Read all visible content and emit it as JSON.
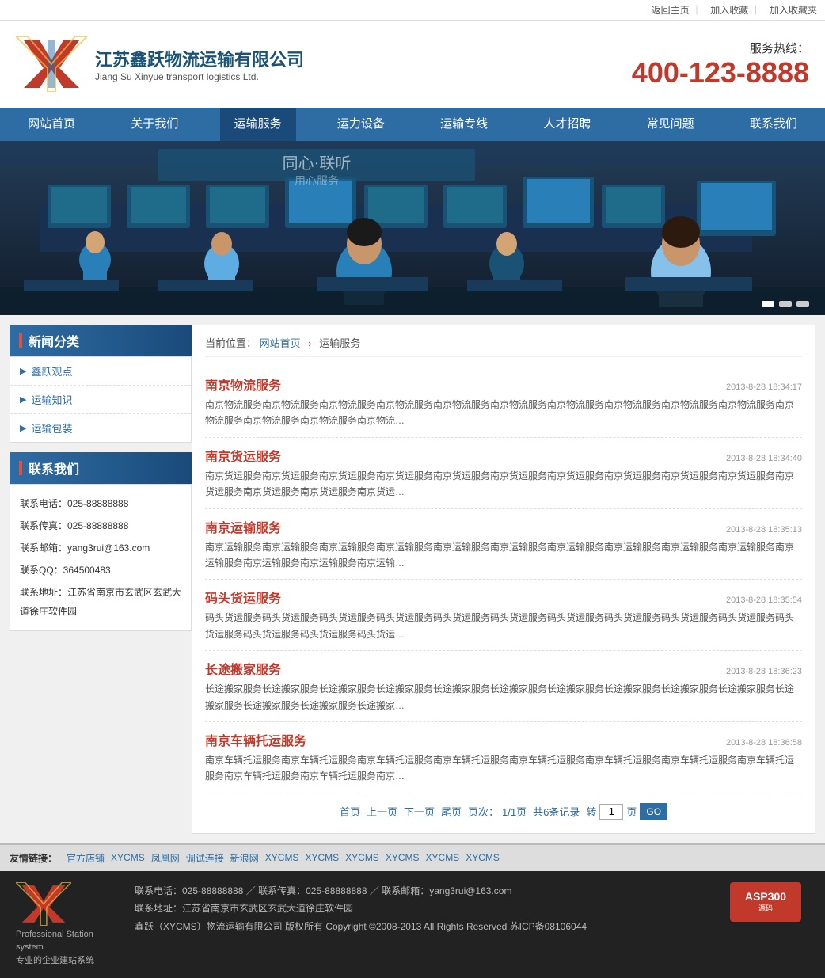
{
  "topbar": {
    "return_home": "返回主页",
    "add_bookmark": "加入收藏",
    "add_favorites": "加入收藏夹"
  },
  "header": {
    "company_cn": "江苏鑫跃物流运输有限公司",
    "company_en": "Jiang Su Xinyue transport logistics Ltd.",
    "hotline_label": "服务热线：",
    "hotline_number": "400-123-8888"
  },
  "nav": {
    "items": [
      {
        "label": "网站首页",
        "active": false
      },
      {
        "label": "关于我们",
        "active": false
      },
      {
        "label": "运输服务",
        "active": true
      },
      {
        "label": "运力设备",
        "active": false
      },
      {
        "label": "运输专线",
        "active": false
      },
      {
        "label": "人才招聘",
        "active": false
      },
      {
        "label": "常见问题",
        "active": false
      },
      {
        "label": "联系我们",
        "active": false
      }
    ]
  },
  "breadcrumb": {
    "home": "网站首页",
    "current": "运输服务",
    "prefix": "当前位置："
  },
  "sidebar": {
    "news_title": "新闻分类",
    "news_items": [
      {
        "label": "鑫跃观点"
      },
      {
        "label": "运输知识"
      },
      {
        "label": "运输包装"
      }
    ],
    "contact_title": "联系我们",
    "contact_phone": "联系电话：025-88888888",
    "contact_fax": "联系传真：025-88888888",
    "contact_email": "联系邮箱：yang3rui@163.com",
    "contact_qq": "联系QQ：364500483",
    "contact_address": "联系地址：江苏省南京市玄武区玄武大道徐庄软件园"
  },
  "articles": [
    {
      "title": "南京物流服务",
      "date": "2013-8-28 18:34:17",
      "excerpt": "南京物流服务南京物流服务南京物流服务南京物流服务南京物流服务南京物流服务南京物流服务南京物流服务南京物流服务南京物流服务南京物流服务南京物流服务南京物流服务南京物流…"
    },
    {
      "title": "南京货运服务",
      "date": "2013-8-28 18:34:40",
      "excerpt": "南京货运服务南京货运服务南京货运服务南京货运服务南京货运服务南京货运服务南京货运服务南京货运服务南京货运服务南京货运服务南京货运服务南京货运服务南京货运服务南京货运…"
    },
    {
      "title": "南京运输服务",
      "date": "2013-8-28 18:35:13",
      "excerpt": "南京运输服务南京运输服务南京运输服务南京运输服务南京运输服务南京运输服务南京运输服务南京运输服务南京运输服务南京运输服务南京运输服务南京运输服务南京运输服务南京运输…"
    },
    {
      "title": "码头货运服务",
      "date": "2013-8-28 18:35:54",
      "excerpt": "码头货运服务码头货运服务码头货运服务码头货运服务码头货运服务码头货运服务码头货运服务码头货运服务码头货运服务码头货运服务码头货运服务码头货运服务码头货运服务码头货运…"
    },
    {
      "title": "长途搬家服务",
      "date": "2013-8-28 18:36:23",
      "excerpt": "长途搬家服务长途搬家服务长途搬家服务长途搬家服务长途搬家服务长途搬家服务长途搬家服务长途搬家服务长途搬家服务长途搬家服务长途搬家服务长途搬家服务长途搬家服务长途搬家…"
    },
    {
      "title": "南京车辆托运服务",
      "date": "2013-8-28 18:36:58",
      "excerpt": "南京车辆托运服务南京车辆托运服务南京车辆托运服务南京车辆托运服务南京车辆托运服务南京车辆托运服务南京车辆托运服务南京车辆托运服务南京车辆托运服务南京车辆托运服务南京…"
    }
  ],
  "pagination": {
    "first": "首页",
    "prev": "上一页",
    "next": "下一页",
    "last": "尾页",
    "page_label": "页次：",
    "page_current": "1/1页",
    "total_label": "共6条记录",
    "goto_label": "转",
    "page_input": "1",
    "go_button": "GO"
  },
  "friend_links": {
    "label": "友情链接：",
    "items": [
      {
        "label": "官方店铺"
      },
      {
        "label": "XYCMS"
      },
      {
        "label": "凤凰网"
      },
      {
        "label": "调试连接"
      },
      {
        "label": "新浪网"
      },
      {
        "label": "XYCMS"
      },
      {
        "label": "XYCMS"
      },
      {
        "label": "XYCMS"
      },
      {
        "label": "XYCMS"
      },
      {
        "label": "XYCMS"
      },
      {
        "label": "XYCMS"
      }
    ]
  },
  "footer": {
    "phone": "联系电话：025-88888888",
    "fax": "联系传真：025-88888888",
    "email": "联系邮箱：yang3rui@163.com",
    "address": "联系地址：江苏省南京市玄武区玄武大道徐庄软件园",
    "copyright": "鑫跃（XYCMS）物流运输有限公司  版权所有 Copyright ©2008-2013  All Rights Reserved    苏ICP备08106044",
    "logo_sub": "Professional Station system\n专业的企业建站系统"
  }
}
